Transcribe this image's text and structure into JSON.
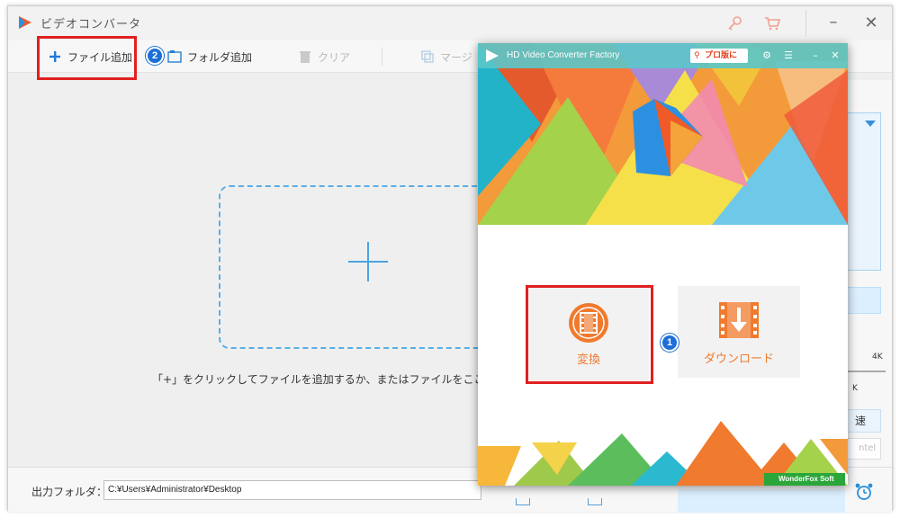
{
  "main": {
    "title": "ビデオコンバータ",
    "toolbar": {
      "add_file": "ファイル追加",
      "add_folder": "フォルダ追加",
      "clear": "クリア",
      "merge": "マージ"
    },
    "hint": "「+」をクリックしてファイルを追加するか、またはファイルをここ",
    "output_label": "出力フォルダ：",
    "output_path": "C:¥Users¥Administrator¥Desktop",
    "right_panel": {
      "res_label": "4K",
      "k_label": "K",
      "speed_label": "速",
      "intel_label": "ntel"
    }
  },
  "launcher": {
    "title": "HD Video Converter Factory",
    "pro_label": "プロ版に",
    "convert_label": "変換",
    "download_label": "ダウンロード",
    "brand": "WonderFox Soft"
  },
  "badges": {
    "step1": "1",
    "step2": "2"
  },
  "colors": {
    "accent_blue": "#1c6fd6",
    "highlight_red": "#e02020",
    "tile_orange": "#f07a2e",
    "dashed_blue": "#5aaee6"
  },
  "icons": {
    "app": "app-logo-icon",
    "key": "key-icon",
    "cart": "cart-icon",
    "add": "plus-icon",
    "folder": "folder-icon",
    "trash": "trash-icon",
    "merge": "merge-icon",
    "film": "film-icon",
    "download": "download-icon",
    "settings": "gear-icon",
    "menu": "list-menu-icon",
    "alarm": "alarm-clock-icon"
  }
}
